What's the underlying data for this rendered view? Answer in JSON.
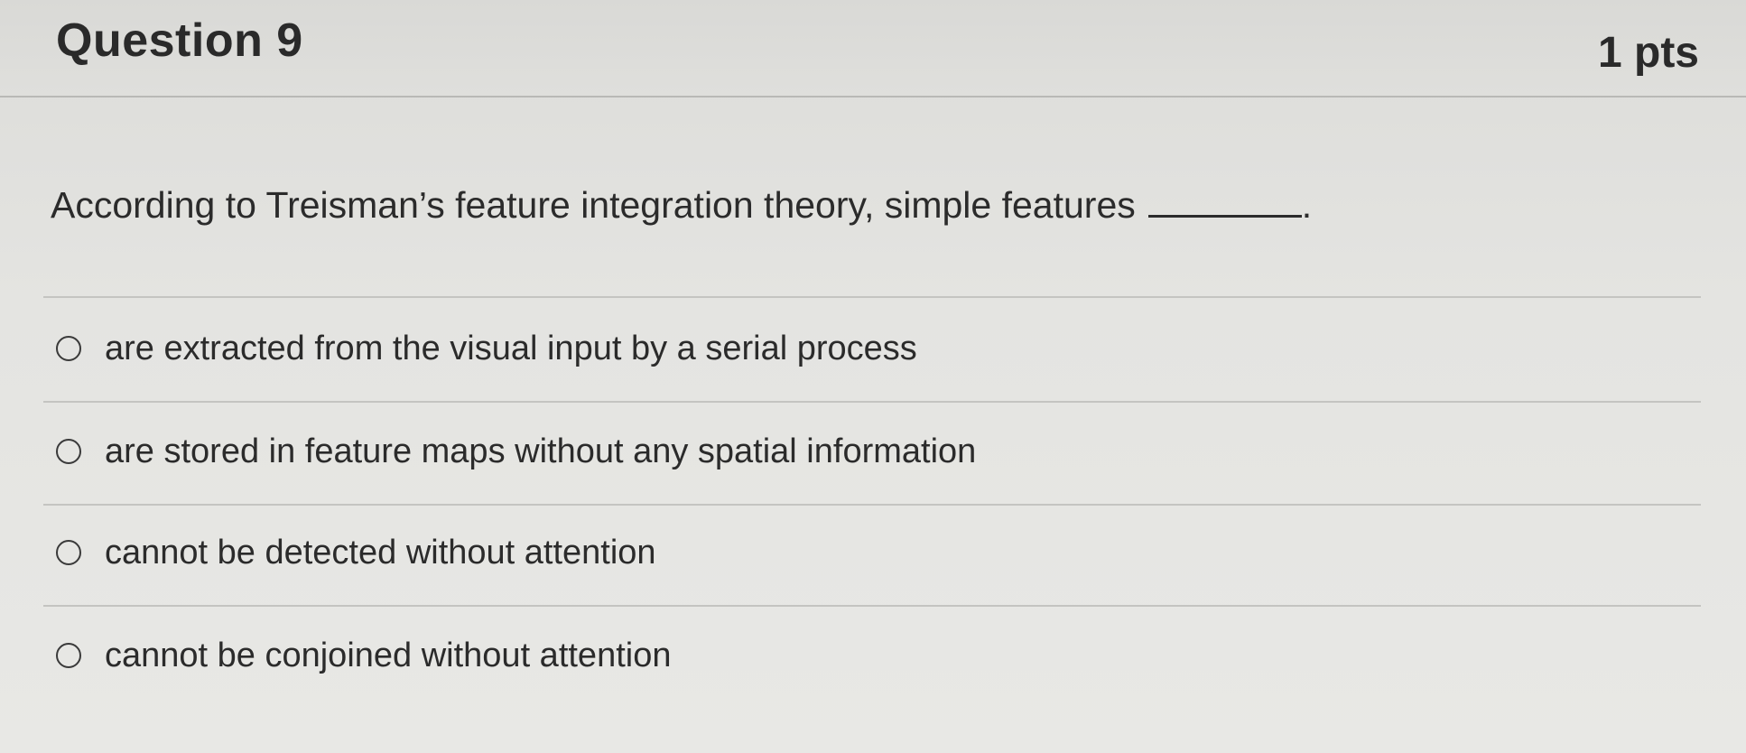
{
  "question": {
    "title": "Question 9",
    "points": "1 pts",
    "text": "According to Treisman’s feature integration theory, simple features",
    "text_end": "."
  },
  "answers": [
    {
      "label": "are extracted from the visual input by a serial process",
      "selected": false
    },
    {
      "label": "are stored in feature maps without any spatial information",
      "selected": false
    },
    {
      "label": "cannot be detected without attention",
      "selected": false
    },
    {
      "label": "cannot be conjoined without attention",
      "selected": false
    }
  ]
}
